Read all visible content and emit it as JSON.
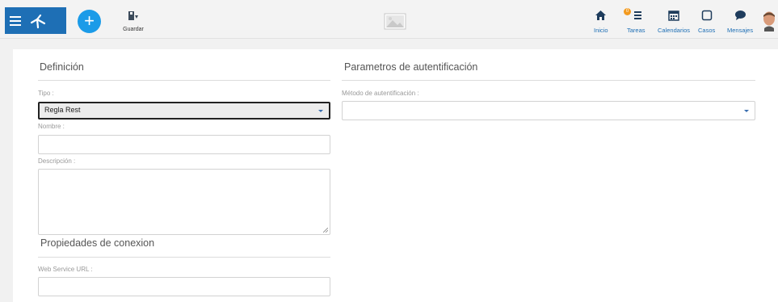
{
  "toolbar": {
    "save_label": "Guardar"
  },
  "nav": [
    {
      "label": "Inicio",
      "icon": "home-icon"
    },
    {
      "label": "Tareas",
      "icon": "tasks-icon",
      "badge": "0"
    },
    {
      "label": "Calendarios",
      "icon": "calendar-icon"
    },
    {
      "label": "Casos",
      "icon": "cases-icon"
    },
    {
      "label": "Mensajes",
      "icon": "messages-icon"
    }
  ],
  "definition": {
    "title": "Definición",
    "tipo_label": "Tipo :",
    "tipo_value": "Regla Rest",
    "nombre_label": "Nombre :",
    "nombre_value": "",
    "descripcion_label": "Descripción :",
    "descripcion_value": ""
  },
  "connection": {
    "title": "Propiedades de conexion",
    "url_label": "Web Service URL :",
    "url_value": ""
  },
  "auth": {
    "title": "Parametros de autentificación",
    "method_label": "Método de autentificación :",
    "method_value": ""
  },
  "colors": {
    "brand": "#1e6fb5",
    "accent": "#1b9be8",
    "badge": "#f39a1e"
  }
}
